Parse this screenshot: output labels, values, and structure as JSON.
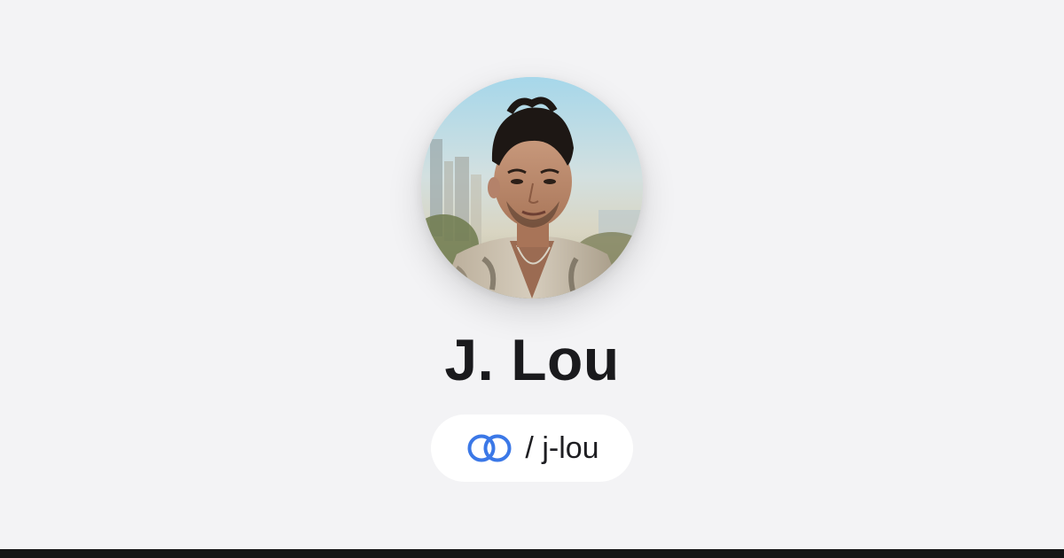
{
  "profile": {
    "name": "J. Lou",
    "handle": "/ j-lou"
  },
  "icons": {
    "avatar": "profile-photo",
    "link": "linked-rings-icon"
  },
  "colors": {
    "background": "#f3f3f5",
    "accent": "#3b78e7",
    "text": "#1a1a1d",
    "bottom_bar": "#141416"
  }
}
